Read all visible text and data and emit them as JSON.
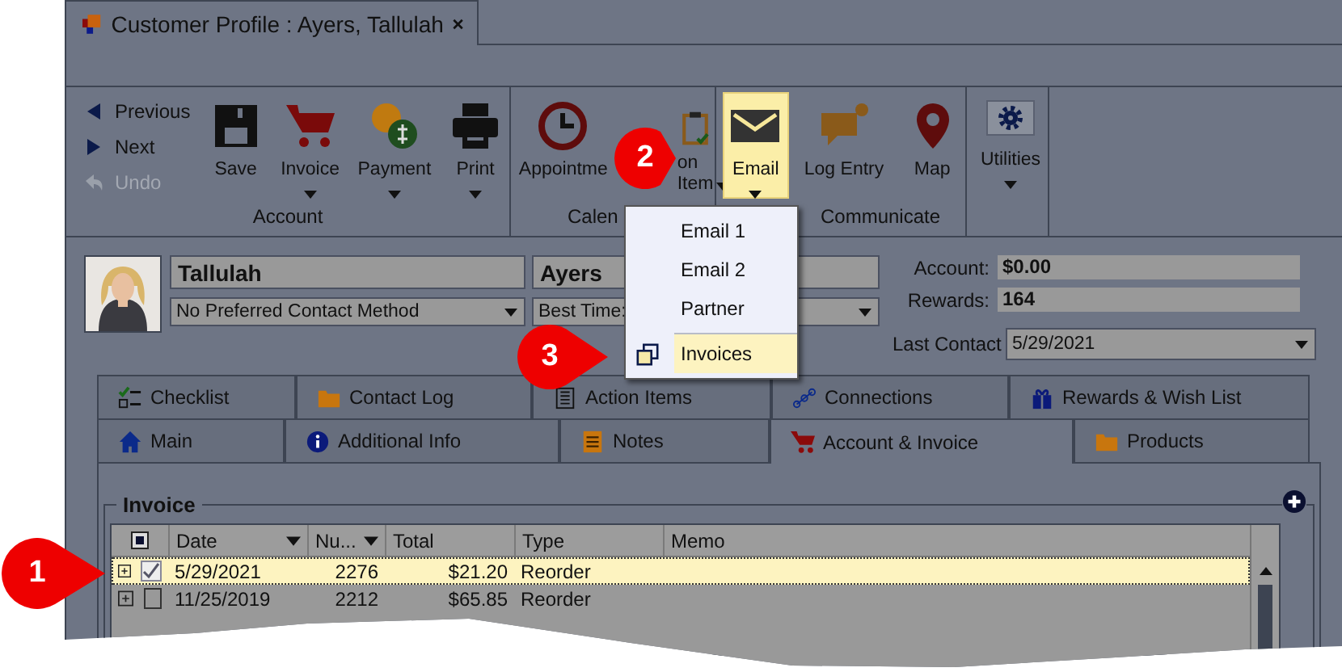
{
  "window": {
    "title": "Customer Profile : Ayers, Tallulah"
  },
  "navigation": [
    {
      "label": "Previous",
      "disabled": false
    },
    {
      "label": "Next",
      "disabled": false
    },
    {
      "label": "Undo",
      "disabled": true
    }
  ],
  "ribbon_groups": [
    {
      "label": "Account",
      "buttons": [
        {
          "label": "Save",
          "dropdown": false,
          "selected": false
        },
        {
          "label": "Invoice",
          "dropdown": true,
          "selected": false
        },
        {
          "label": "Payment",
          "dropdown": true,
          "selected": false
        },
        {
          "label": "Print",
          "dropdown": true,
          "selected": false
        }
      ]
    },
    {
      "label": "Calen",
      "buttons": [
        {
          "label": "Appointme",
          "dropdown": false,
          "selected": false
        },
        {
          "label": "on",
          "label_line_2": "Item",
          "dropdown": true,
          "selected": false
        }
      ]
    },
    {
      "label": "Communicate",
      "buttons": [
        {
          "label": "Email",
          "dropdown": true,
          "selected": true
        },
        {
          "label": "Log Entry",
          "dropdown": false,
          "selected": false
        },
        {
          "label": "Map",
          "dropdown": false,
          "selected": false
        }
      ]
    },
    {
      "buttons": [
        {
          "label": "Utilities",
          "dropdown": true,
          "selected": false
        }
      ]
    }
  ],
  "email_menu": [
    {
      "label": "Email 1",
      "selected": false,
      "separator_before": false
    },
    {
      "label": "Email 2",
      "selected": false,
      "separator_before": false
    },
    {
      "label": "Partner",
      "selected": false,
      "separator_before": false
    },
    {
      "label": "Invoices",
      "selected": true,
      "separator_before": true
    }
  ],
  "profile": {
    "first_name": "Tallulah",
    "last_name": "Ayers",
    "contact_method": "No Preferred Contact Method",
    "best_time": "Best Time:",
    "account_label": "Account:",
    "account": "$0.00",
    "rewards_label": "Rewards:",
    "rewards": "164",
    "last_contact_label": "Last Contact",
    "last_contact": "5/29/2021"
  },
  "tabs_row_1": [
    {
      "label": "Checklist",
      "selected": false
    },
    {
      "label": "Contact Log",
      "selected": false
    },
    {
      "label": "Action Items",
      "selected": false
    },
    {
      "label": "Connections",
      "selected": false
    },
    {
      "label": "Rewards & Wish List",
      "selected": false
    }
  ],
  "tabs_row_2": [
    {
      "label": "Main",
      "selected": false
    },
    {
      "label": "Additional Info",
      "selected": false
    },
    {
      "label": "Notes",
      "selected": false
    },
    {
      "label": "Account & Invoice",
      "selected": true
    },
    {
      "label": "Products",
      "selected": false
    }
  ],
  "invoice": {
    "title": "Invoice",
    "select_all_partial": true,
    "columns": [
      {
        "label": "Date",
        "dropdown": true
      },
      {
        "label": "Nu...",
        "dropdown": true
      },
      {
        "label": "Total",
        "dropdown": false
      },
      {
        "label": "Type",
        "dropdown": false
      },
      {
        "label": "Memo",
        "dropdown": false
      }
    ],
    "rows": [
      {
        "date": "5/29/2021",
        "number": "2276",
        "total": "$21.20",
        "type": "Reorder",
        "checked": true,
        "selected": true
      },
      {
        "date": "11/25/2019",
        "number": "2212",
        "total": "$65.85",
        "type": "Reorder",
        "checked": false,
        "selected": false
      }
    ]
  },
  "callouts": [
    {
      "label": "1"
    },
    {
      "label": "2"
    },
    {
      "label": "3"
    }
  ]
}
